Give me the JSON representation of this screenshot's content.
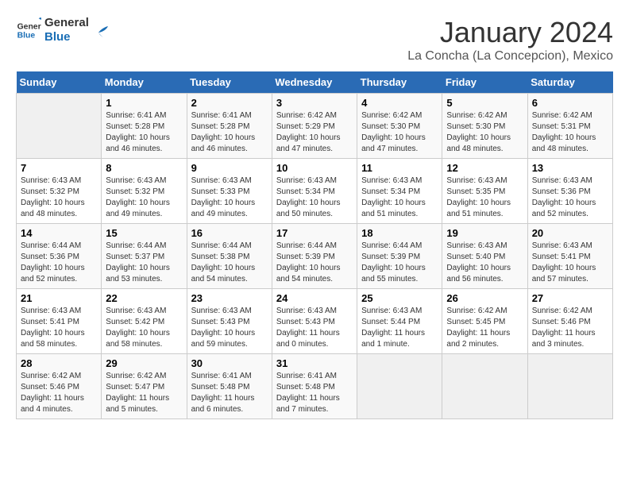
{
  "logo": {
    "text_general": "General",
    "text_blue": "Blue"
  },
  "calendar": {
    "title": "January 2024",
    "subtitle": "La Concha (La Concepcion), Mexico"
  },
  "headers": [
    "Sunday",
    "Monday",
    "Tuesday",
    "Wednesday",
    "Thursday",
    "Friday",
    "Saturday"
  ],
  "weeks": [
    [
      {
        "day": "",
        "sunrise": "",
        "sunset": "",
        "daylight": ""
      },
      {
        "day": "1",
        "sunrise": "Sunrise: 6:41 AM",
        "sunset": "Sunset: 5:28 PM",
        "daylight": "Daylight: 10 hours and 46 minutes."
      },
      {
        "day": "2",
        "sunrise": "Sunrise: 6:41 AM",
        "sunset": "Sunset: 5:28 PM",
        "daylight": "Daylight: 10 hours and 46 minutes."
      },
      {
        "day": "3",
        "sunrise": "Sunrise: 6:42 AM",
        "sunset": "Sunset: 5:29 PM",
        "daylight": "Daylight: 10 hours and 47 minutes."
      },
      {
        "day": "4",
        "sunrise": "Sunrise: 6:42 AM",
        "sunset": "Sunset: 5:30 PM",
        "daylight": "Daylight: 10 hours and 47 minutes."
      },
      {
        "day": "5",
        "sunrise": "Sunrise: 6:42 AM",
        "sunset": "Sunset: 5:30 PM",
        "daylight": "Daylight: 10 hours and 48 minutes."
      },
      {
        "day": "6",
        "sunrise": "Sunrise: 6:42 AM",
        "sunset": "Sunset: 5:31 PM",
        "daylight": "Daylight: 10 hours and 48 minutes."
      }
    ],
    [
      {
        "day": "7",
        "sunrise": "Sunrise: 6:43 AM",
        "sunset": "Sunset: 5:32 PM",
        "daylight": "Daylight: 10 hours and 48 minutes."
      },
      {
        "day": "8",
        "sunrise": "Sunrise: 6:43 AM",
        "sunset": "Sunset: 5:32 PM",
        "daylight": "Daylight: 10 hours and 49 minutes."
      },
      {
        "day": "9",
        "sunrise": "Sunrise: 6:43 AM",
        "sunset": "Sunset: 5:33 PM",
        "daylight": "Daylight: 10 hours and 49 minutes."
      },
      {
        "day": "10",
        "sunrise": "Sunrise: 6:43 AM",
        "sunset": "Sunset: 5:34 PM",
        "daylight": "Daylight: 10 hours and 50 minutes."
      },
      {
        "day": "11",
        "sunrise": "Sunrise: 6:43 AM",
        "sunset": "Sunset: 5:34 PM",
        "daylight": "Daylight: 10 hours and 51 minutes."
      },
      {
        "day": "12",
        "sunrise": "Sunrise: 6:43 AM",
        "sunset": "Sunset: 5:35 PM",
        "daylight": "Daylight: 10 hours and 51 minutes."
      },
      {
        "day": "13",
        "sunrise": "Sunrise: 6:43 AM",
        "sunset": "Sunset: 5:36 PM",
        "daylight": "Daylight: 10 hours and 52 minutes."
      }
    ],
    [
      {
        "day": "14",
        "sunrise": "Sunrise: 6:44 AM",
        "sunset": "Sunset: 5:36 PM",
        "daylight": "Daylight: 10 hours and 52 minutes."
      },
      {
        "day": "15",
        "sunrise": "Sunrise: 6:44 AM",
        "sunset": "Sunset: 5:37 PM",
        "daylight": "Daylight: 10 hours and 53 minutes."
      },
      {
        "day": "16",
        "sunrise": "Sunrise: 6:44 AM",
        "sunset": "Sunset: 5:38 PM",
        "daylight": "Daylight: 10 hours and 54 minutes."
      },
      {
        "day": "17",
        "sunrise": "Sunrise: 6:44 AM",
        "sunset": "Sunset: 5:39 PM",
        "daylight": "Daylight: 10 hours and 54 minutes."
      },
      {
        "day": "18",
        "sunrise": "Sunrise: 6:44 AM",
        "sunset": "Sunset: 5:39 PM",
        "daylight": "Daylight: 10 hours and 55 minutes."
      },
      {
        "day": "19",
        "sunrise": "Sunrise: 6:43 AM",
        "sunset": "Sunset: 5:40 PM",
        "daylight": "Daylight: 10 hours and 56 minutes."
      },
      {
        "day": "20",
        "sunrise": "Sunrise: 6:43 AM",
        "sunset": "Sunset: 5:41 PM",
        "daylight": "Daylight: 10 hours and 57 minutes."
      }
    ],
    [
      {
        "day": "21",
        "sunrise": "Sunrise: 6:43 AM",
        "sunset": "Sunset: 5:41 PM",
        "daylight": "Daylight: 10 hours and 58 minutes."
      },
      {
        "day": "22",
        "sunrise": "Sunrise: 6:43 AM",
        "sunset": "Sunset: 5:42 PM",
        "daylight": "Daylight: 10 hours and 58 minutes."
      },
      {
        "day": "23",
        "sunrise": "Sunrise: 6:43 AM",
        "sunset": "Sunset: 5:43 PM",
        "daylight": "Daylight: 10 hours and 59 minutes."
      },
      {
        "day": "24",
        "sunrise": "Sunrise: 6:43 AM",
        "sunset": "Sunset: 5:43 PM",
        "daylight": "Daylight: 11 hours and 0 minutes."
      },
      {
        "day": "25",
        "sunrise": "Sunrise: 6:43 AM",
        "sunset": "Sunset: 5:44 PM",
        "daylight": "Daylight: 11 hours and 1 minute."
      },
      {
        "day": "26",
        "sunrise": "Sunrise: 6:42 AM",
        "sunset": "Sunset: 5:45 PM",
        "daylight": "Daylight: 11 hours and 2 minutes."
      },
      {
        "day": "27",
        "sunrise": "Sunrise: 6:42 AM",
        "sunset": "Sunset: 5:46 PM",
        "daylight": "Daylight: 11 hours and 3 minutes."
      }
    ],
    [
      {
        "day": "28",
        "sunrise": "Sunrise: 6:42 AM",
        "sunset": "Sunset: 5:46 PM",
        "daylight": "Daylight: 11 hours and 4 minutes."
      },
      {
        "day": "29",
        "sunrise": "Sunrise: 6:42 AM",
        "sunset": "Sunset: 5:47 PM",
        "daylight": "Daylight: 11 hours and 5 minutes."
      },
      {
        "day": "30",
        "sunrise": "Sunrise: 6:41 AM",
        "sunset": "Sunset: 5:48 PM",
        "daylight": "Daylight: 11 hours and 6 minutes."
      },
      {
        "day": "31",
        "sunrise": "Sunrise: 6:41 AM",
        "sunset": "Sunset: 5:48 PM",
        "daylight": "Daylight: 11 hours and 7 minutes."
      },
      {
        "day": "",
        "sunrise": "",
        "sunset": "",
        "daylight": ""
      },
      {
        "day": "",
        "sunrise": "",
        "sunset": "",
        "daylight": ""
      },
      {
        "day": "",
        "sunrise": "",
        "sunset": "",
        "daylight": ""
      }
    ]
  ]
}
